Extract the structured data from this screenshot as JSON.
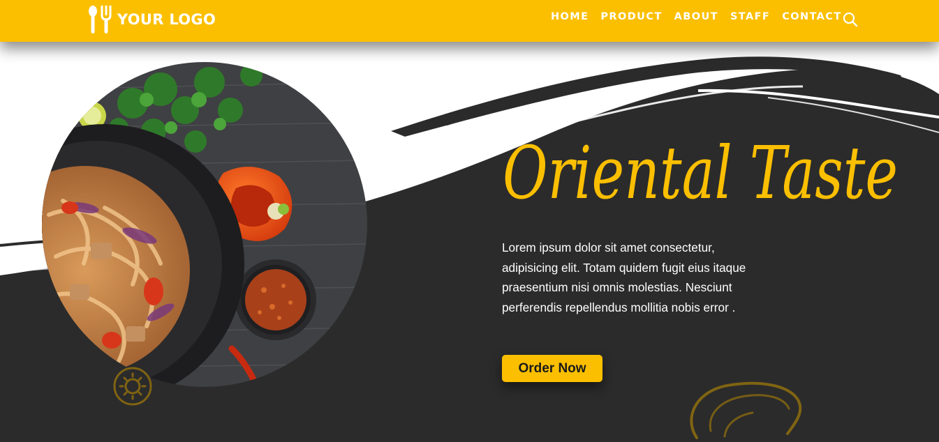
{
  "brand": {
    "logo_text": "YOUR LOGO",
    "logo_icon": "spoon-fork-icon",
    "accent_color": "#fbbf00",
    "dark_color": "#2b2b2b"
  },
  "nav": {
    "items": [
      {
        "label": "HOME"
      },
      {
        "label": "PRODUCT"
      },
      {
        "label": "ABOUT"
      },
      {
        "label": "STAFF"
      },
      {
        "label": "CONTACT"
      }
    ],
    "search_icon": "search-icon"
  },
  "hero": {
    "title": "Oriental Taste",
    "description": "Lorem ipsum dolor sit amet consectetur, adipisicing elit. Totam quidem fugit eius itaque praesentium nisi omnis molestias. Nesciunt perferendis repellendus mollitia nobis error .",
    "cta_label": "Order Now",
    "image": "stir-fried-noodles-in-wok-photo"
  }
}
